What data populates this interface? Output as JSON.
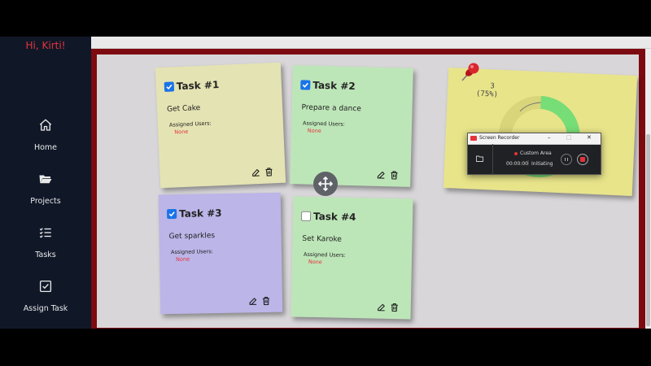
{
  "sidebar": {
    "greeting": "Hi, Kirti!",
    "nav": [
      {
        "label": "Home",
        "icon": "home-icon"
      },
      {
        "label": "Projects",
        "icon": "folder-open-icon"
      },
      {
        "label": "Tasks",
        "icon": "list-icon"
      },
      {
        "label": "Assign Task",
        "icon": "check-square-icon"
      }
    ]
  },
  "tasks": [
    {
      "title": "Task #1",
      "checked": true,
      "description": "Get Cake",
      "assigned_label": "Assigned Users:",
      "assigned_value": "None",
      "color": "#e4e3b3"
    },
    {
      "title": "Task #2",
      "checked": true,
      "description": "Prepare a dance",
      "assigned_label": "Assigned Users:",
      "assigned_value": "None",
      "color": "#bde6b8"
    },
    {
      "title": "Task #3",
      "checked": true,
      "description": "Get sparkles",
      "assigned_label": "Assigned Users:",
      "assigned_value": "None",
      "color": "#bcb5e8"
    },
    {
      "title": "Task #4",
      "checked": false,
      "description": "Set Karoke",
      "assigned_label": "Assigned Users:",
      "assigned_value": "None",
      "color": "#bde6b8"
    }
  ],
  "progress_note": {
    "count": "3",
    "percent_label": "(75%)",
    "progress": 0.75,
    "color": "#e8e48a",
    "ring_color": "#77dd77"
  },
  "screen_recorder": {
    "title": "Screen Recorder",
    "mode": "Custom Area",
    "timer": "00:00:00",
    "status": "Initiating"
  },
  "colors": {
    "accent_red": "#e5333b",
    "sidebar_bg": "#101828",
    "board_border": "#7d0a10",
    "checkbox_blue": "#1a73e8"
  }
}
